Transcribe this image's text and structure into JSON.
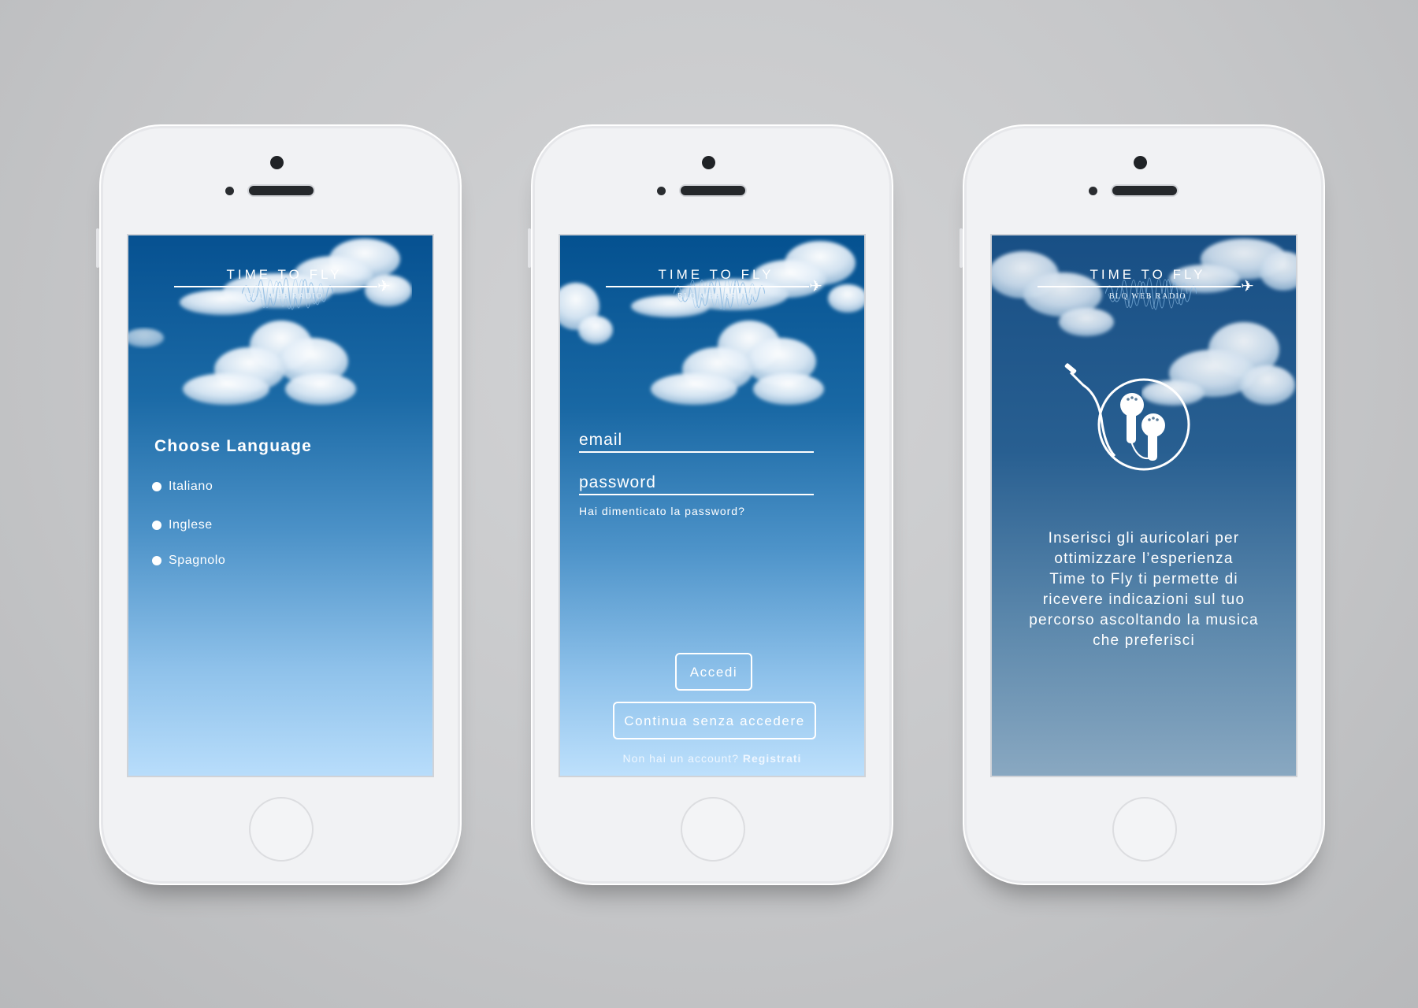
{
  "brand": {
    "title": "TIME TO FLY",
    "subtitle": "BLQ WEB RADIO"
  },
  "language_screen": {
    "heading": "Choose Language",
    "options": [
      {
        "label": "Italiano"
      },
      {
        "label": "Inglese"
      },
      {
        "label": "Spagnolo"
      }
    ]
  },
  "login_screen": {
    "email_label": "email",
    "password_label": "password",
    "forgot_link": "Hai dimenticato la password?",
    "login_button": "Accedi",
    "guest_button": "Continua senza accedere",
    "signup_prompt": "Non hai un account?",
    "signup_link": "Registrati"
  },
  "headphones_screen": {
    "message_lines": [
      "Inserisci gli auricolari per",
      "ottimizzare l’esperienza",
      "Time to Fly ti permette di",
      "ricevere indicazioni sul tuo",
      "percorso ascoltando la musica",
      "che preferisci"
    ]
  },
  "icons": {
    "plane": "airplane-icon",
    "earbuds": "earbuds-icon",
    "radio_dot": "radio-dot-icon"
  },
  "colors": {
    "sky_top": "#065191",
    "sky_bottom": "#b8ddfb",
    "headphones_sky_top": "#184f85",
    "headphones_sky_bottom": "#89a8c1",
    "phone_body": "#f1f2f4",
    "background": "#c6c7c9"
  }
}
